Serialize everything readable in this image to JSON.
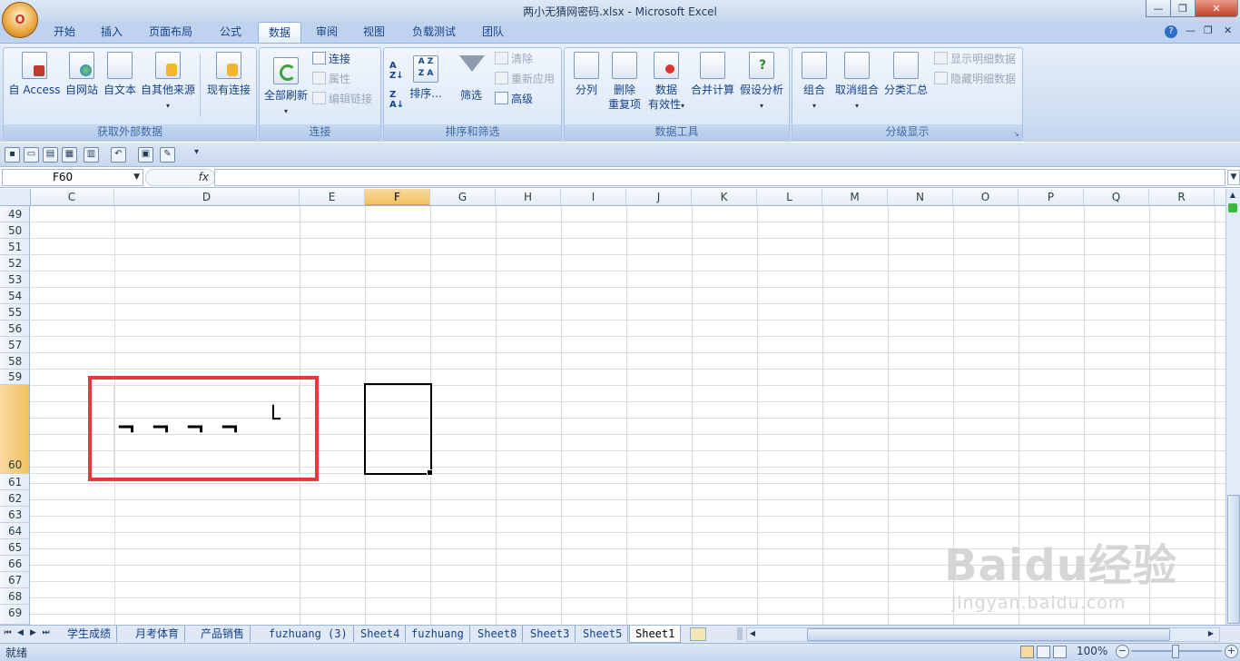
{
  "window": {
    "title": "两小无猜网密码.xlsx - Microsoft Excel",
    "minimize": "—",
    "restore": "❐",
    "close": "✕",
    "office_glyph": "O"
  },
  "tabs": [
    "开始",
    "插入",
    "页面布局",
    "公式",
    "数据",
    "审阅",
    "视图",
    "负载测试",
    "团队"
  ],
  "active_tab": "数据",
  "ribbon": {
    "get_external": {
      "label": "获取外部数据",
      "buttons": [
        "自 Access",
        "自网站",
        "自文本",
        "自其他来源",
        "现有连接"
      ]
    },
    "connections": {
      "label": "连接",
      "refresh_all": "全部刷新",
      "connections": "连接",
      "properties": "属性",
      "edit_links": "编辑链接"
    },
    "sort_filter": {
      "label": "排序和筛选",
      "sort": "排序...",
      "filter": "筛选",
      "clear": "清除",
      "reapply": "重新应用",
      "advanced": "高级"
    },
    "data_tools": {
      "label": "数据工具",
      "text_to_columns": "分列",
      "remove_dup_1": "删除",
      "remove_dup_2": "重复项",
      "validation_1": "数据",
      "validation_2": "有效性",
      "consolidate": "合并计算",
      "what_if": "假设分析"
    },
    "outline": {
      "label": "分级显示",
      "group": "组合",
      "ungroup": "取消组合",
      "subtotal": "分类汇总",
      "show_detail": "显示明细数据",
      "hide_detail": "隐藏明细数据"
    }
  },
  "formula_bar": {
    "name_box": "F60",
    "fx": "fx",
    "formula": ""
  },
  "columns": [
    "C",
    "D",
    "E",
    "F",
    "G",
    "H",
    "I",
    "J",
    "K",
    "L",
    "M",
    "N",
    "O",
    "P",
    "Q",
    "R"
  ],
  "selected_column": "F",
  "rows": [
    "49",
    "50",
    "51",
    "52",
    "53",
    "54",
    "55",
    "56",
    "57",
    "58",
    "59",
    "60",
    "61",
    "62",
    "63",
    "64",
    "65",
    "66",
    "67",
    "68",
    "69"
  ],
  "selected_row": "60",
  "cell_symbols": [
    "¬",
    "¬",
    "¬",
    "¬",
    "└"
  ],
  "sheets": [
    "学生成绩",
    "月考体育",
    "产品销售",
    "fuzhuang (3)",
    "Sheet4",
    "fuzhuang",
    "Sheet8",
    "Sheet3",
    "Sheet5",
    "Sheet1"
  ],
  "active_sheet": "Sheet1",
  "status": {
    "ready": "就绪",
    "zoom": "100%"
  },
  "watermark": {
    "logo": "Baidu经验",
    "url": "jingyan.baidu.com"
  },
  "colors": {
    "highlight_box": "#e63a3f",
    "selected_header": "#f1c15f"
  }
}
